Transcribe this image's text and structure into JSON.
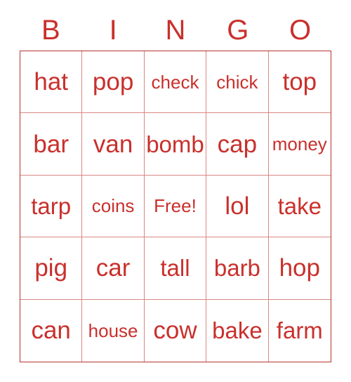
{
  "card": {
    "title": "BINGO",
    "text_color": "#C9302C",
    "grid_border_color": "#B5332F",
    "grid_line_color": "#D98884",
    "background_color": "#FFFFFF",
    "columns": 5,
    "rows": 5,
    "header": {
      "letters": [
        "B",
        "I",
        "N",
        "G",
        "O"
      ]
    },
    "cells": [
      {
        "text": "hat",
        "column": "B",
        "row": 1,
        "free": false
      },
      {
        "text": "pop",
        "column": "I",
        "row": 1,
        "free": false
      },
      {
        "text": "check",
        "column": "N",
        "row": 1,
        "free": false
      },
      {
        "text": "chick",
        "column": "G",
        "row": 1,
        "free": false
      },
      {
        "text": "top",
        "column": "O",
        "row": 1,
        "free": false
      },
      {
        "text": "bar",
        "column": "B",
        "row": 2,
        "free": false
      },
      {
        "text": "van",
        "column": "I",
        "row": 2,
        "free": false
      },
      {
        "text": "bomb",
        "column": "N",
        "row": 2,
        "free": false
      },
      {
        "text": "cap",
        "column": "G",
        "row": 2,
        "free": false
      },
      {
        "text": "money",
        "column": "O",
        "row": 2,
        "free": false
      },
      {
        "text": "tarp",
        "column": "B",
        "row": 3,
        "free": false
      },
      {
        "text": "coins",
        "column": "I",
        "row": 3,
        "free": false
      },
      {
        "text": "Free!",
        "column": "N",
        "row": 3,
        "free": true
      },
      {
        "text": "lol",
        "column": "G",
        "row": 3,
        "free": false
      },
      {
        "text": "take",
        "column": "O",
        "row": 3,
        "free": false
      },
      {
        "text": "pig",
        "column": "B",
        "row": 4,
        "free": false
      },
      {
        "text": "car",
        "column": "I",
        "row": 4,
        "free": false
      },
      {
        "text": "tall",
        "column": "N",
        "row": 4,
        "free": false
      },
      {
        "text": "barb",
        "column": "G",
        "row": 4,
        "free": false
      },
      {
        "text": "hop",
        "column": "O",
        "row": 4,
        "free": false
      },
      {
        "text": "can",
        "column": "B",
        "row": 5,
        "free": false
      },
      {
        "text": "house",
        "column": "I",
        "row": 5,
        "free": false
      },
      {
        "text": "cow",
        "column": "N",
        "row": 5,
        "free": false
      },
      {
        "text": "bake",
        "column": "G",
        "row": 5,
        "free": false
      },
      {
        "text": "farm",
        "column": "O",
        "row": 5,
        "free": false
      }
    ]
  }
}
